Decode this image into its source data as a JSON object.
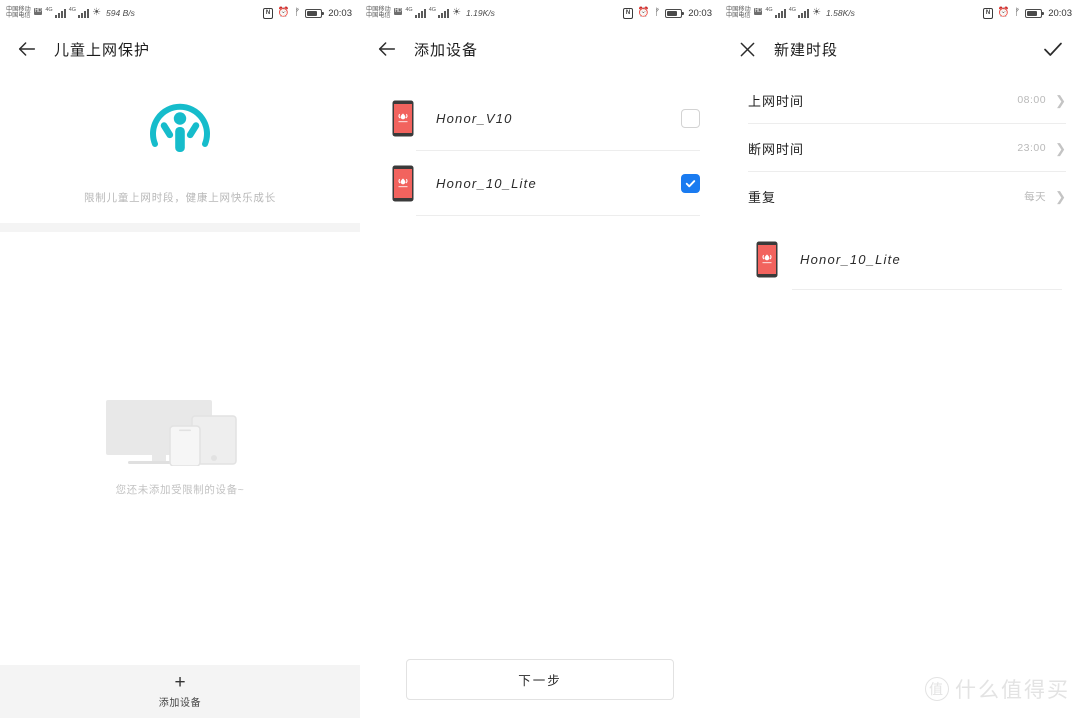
{
  "statusbar": {
    "carrier_top": "中国移动",
    "carrier_bottom": "中国电信",
    "hd_badge": "HD",
    "net_tag_1": "4G",
    "net_tag_2": "4G",
    "time": "20:03",
    "speeds": [
      "594 B/s",
      "1.19K/s",
      "1.58K/s"
    ],
    "icons": [
      "nfc-icon",
      "alarm-icon",
      "bluetooth-icon",
      "battery-icon"
    ]
  },
  "panel1": {
    "title": "儿童上网保护",
    "back_icon": "back-arrow-icon",
    "hero_icon": "child-protection-icon",
    "hero_accent": "#16bccb",
    "subtitle": "限制儿童上网时段，健康上网快乐成长",
    "empty_illustration": "devices-illustration",
    "empty_text": "您还未添加受限制的设备~",
    "add_icon": "plus-icon",
    "add_label": "添加设备"
  },
  "panel2": {
    "title": "添加设备",
    "back_icon": "back-arrow-icon",
    "devices": [
      {
        "name": "Honor_V10",
        "checked": false,
        "icon": "huawei-phone-icon"
      },
      {
        "name": "Honor_10_Lite",
        "checked": true,
        "icon": "huawei-phone-icon"
      }
    ],
    "checkbox_accent": "#1a7bf0",
    "next_label": "下一步"
  },
  "panel3": {
    "title": "新建时段",
    "close_icon": "close-icon",
    "confirm_icon": "check-icon",
    "settings": [
      {
        "label": "上网时间",
        "value": "08:00"
      },
      {
        "label": "断网时间",
        "value": "23:00"
      },
      {
        "label": "重复",
        "value": "每天"
      }
    ],
    "chevron_icon": "chevron-right-icon",
    "device": {
      "name": "Honor_10_Lite",
      "icon": "huawei-phone-icon"
    }
  },
  "watermark": {
    "badge": "值",
    "text": "什么值得买"
  }
}
